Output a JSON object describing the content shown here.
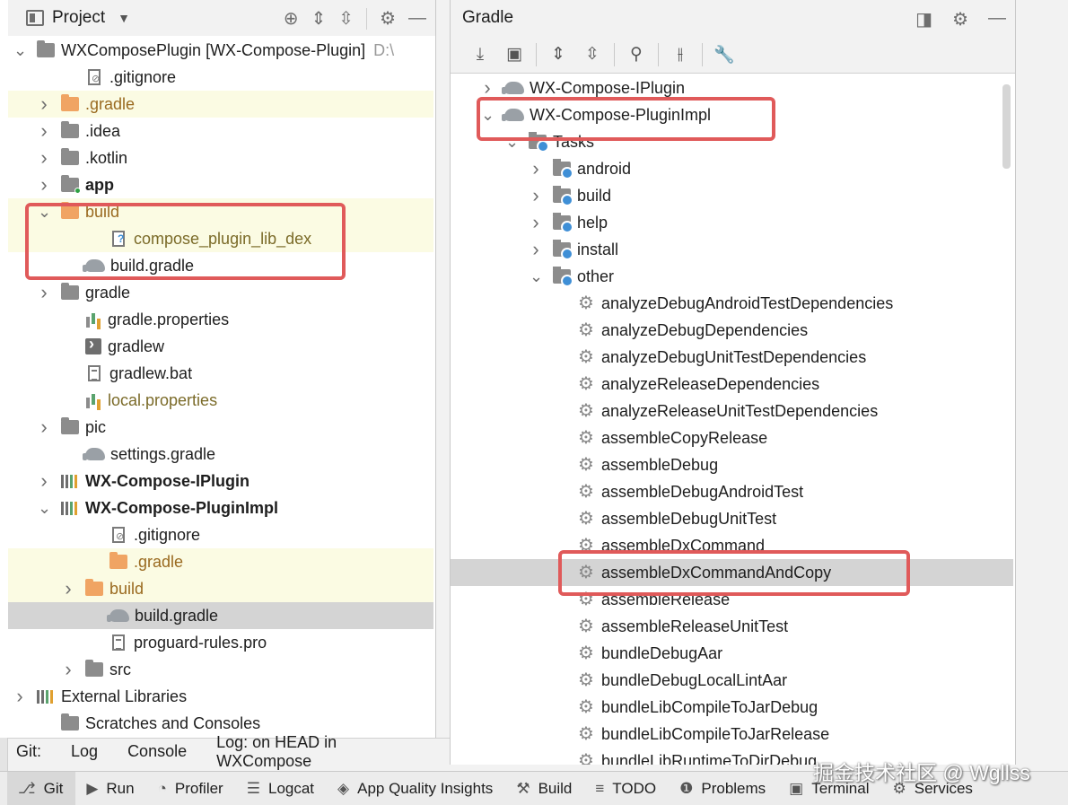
{
  "project_panel": {
    "title": "Project",
    "tree": [
      {
        "label": "WXComposePlugin [WX-Compose-Plugin]",
        "suffix": "D:\\",
        "indent": 0,
        "expanded": true,
        "icon": "module-folder-icon",
        "bold": false
      },
      {
        "label": ".gitignore",
        "indent": 2,
        "icon": "ignore-file-icon"
      },
      {
        "label": ".gradle",
        "indent": 1,
        "collapsed": true,
        "icon": "folder-orange-icon",
        "style": "gradle",
        "yellow": true
      },
      {
        "label": ".idea",
        "indent": 1,
        "collapsed": true,
        "icon": "folder-icon"
      },
      {
        "label": ".kotlin",
        "indent": 1,
        "collapsed": true,
        "icon": "folder-icon"
      },
      {
        "label": "app",
        "indent": 1,
        "collapsed": true,
        "icon": "module-app-icon",
        "bold": true
      },
      {
        "label": "build",
        "indent": 1,
        "expanded": true,
        "icon": "folder-orange-icon",
        "style": "gradle",
        "yellow": true
      },
      {
        "label": "compose_plugin_lib_dex",
        "indent": 3,
        "icon": "unknown-file-icon",
        "style": "olive",
        "yellow": true
      },
      {
        "label": "build.gradle",
        "indent": 2,
        "icon": "gradle-elephant-icon"
      },
      {
        "label": "gradle",
        "indent": 1,
        "collapsed": true,
        "icon": "folder-icon"
      },
      {
        "label": "gradle.properties",
        "indent": 2,
        "icon": "properties-icon"
      },
      {
        "label": "gradlew",
        "indent": 2,
        "icon": "terminal-file-icon"
      },
      {
        "label": "gradlew.bat",
        "indent": 2,
        "icon": "text-file-icon"
      },
      {
        "label": "local.properties",
        "indent": 2,
        "icon": "properties-icon",
        "style": "olive"
      },
      {
        "label": "pic",
        "indent": 1,
        "collapsed": true,
        "icon": "folder-icon"
      },
      {
        "label": "settings.gradle",
        "indent": 2,
        "icon": "gradle-elephant-icon"
      },
      {
        "label": "WX-Compose-IPlugin",
        "indent": 1,
        "collapsed": true,
        "icon": "module-icon",
        "bold": true
      },
      {
        "label": "WX-Compose-PluginImpl",
        "indent": 1,
        "expanded": true,
        "icon": "module-icon",
        "bold": true
      },
      {
        "label": ".gitignore",
        "indent": 3,
        "icon": "ignore-file-icon"
      },
      {
        "label": ".gradle",
        "indent": 3,
        "icon": "folder-orange-icon",
        "style": "gradle",
        "yellow": true
      },
      {
        "label": "build",
        "indent": 2,
        "collapsed": true,
        "icon": "folder-orange-icon",
        "style": "gradle",
        "yellow": true
      },
      {
        "label": "build.gradle",
        "indent": 3,
        "icon": "gradle-elephant-icon",
        "selected": true
      },
      {
        "label": "proguard-rules.pro",
        "indent": 3,
        "icon": "text-file-icon"
      },
      {
        "label": "src",
        "indent": 2,
        "collapsed": true,
        "icon": "folder-icon"
      },
      {
        "label": "External Libraries",
        "indent": 0,
        "collapsed": true,
        "icon": "library-icon"
      },
      {
        "label": "Scratches and Consoles",
        "indent": 1,
        "icon": "scratches-icon"
      }
    ]
  },
  "git_strip": {
    "label": "Git:",
    "tabs": [
      "Log",
      "Console",
      "Log: on HEAD in WXCompose"
    ]
  },
  "gradle_panel": {
    "title": "Gradle",
    "tree": [
      {
        "label": "WX-Compose-IPlugin",
        "indent": 0,
        "collapsed": true,
        "icon": "gradle-elephant-icon"
      },
      {
        "label": "WX-Compose-PluginImpl",
        "indent": 0,
        "expanded": true,
        "icon": "gradle-elephant-icon"
      },
      {
        "label": "Tasks",
        "indent": 1,
        "expanded": true,
        "icon": "task-folder-icon"
      },
      {
        "label": "android",
        "indent": 2,
        "collapsed": true,
        "icon": "task-folder-icon"
      },
      {
        "label": "build",
        "indent": 2,
        "collapsed": true,
        "icon": "task-folder-icon"
      },
      {
        "label": "help",
        "indent": 2,
        "collapsed": true,
        "icon": "task-folder-icon"
      },
      {
        "label": "install",
        "indent": 2,
        "collapsed": true,
        "icon": "task-folder-icon"
      },
      {
        "label": "other",
        "indent": 2,
        "expanded": true,
        "icon": "task-folder-icon"
      },
      {
        "label": "analyzeDebugAndroidTestDependencies",
        "indent": 3,
        "icon": "gear-icon"
      },
      {
        "label": "analyzeDebugDependencies",
        "indent": 3,
        "icon": "gear-icon"
      },
      {
        "label": "analyzeDebugUnitTestDependencies",
        "indent": 3,
        "icon": "gear-icon"
      },
      {
        "label": "analyzeReleaseDependencies",
        "indent": 3,
        "icon": "gear-icon"
      },
      {
        "label": "analyzeReleaseUnitTestDependencies",
        "indent": 3,
        "icon": "gear-icon"
      },
      {
        "label": "assembleCopyRelease",
        "indent": 3,
        "icon": "gear-icon"
      },
      {
        "label": "assembleDebug",
        "indent": 3,
        "icon": "gear-icon"
      },
      {
        "label": "assembleDebugAndroidTest",
        "indent": 3,
        "icon": "gear-icon"
      },
      {
        "label": "assembleDebugUnitTest",
        "indent": 3,
        "icon": "gear-icon"
      },
      {
        "label": "assembleDxCommand",
        "indent": 3,
        "icon": "gear-icon"
      },
      {
        "label": "assembleDxCommandAndCopy",
        "indent": 3,
        "icon": "gear-icon",
        "selected": true
      },
      {
        "label": "assembleRelease",
        "indent": 3,
        "icon": "gear-icon"
      },
      {
        "label": "assembleReleaseUnitTest",
        "indent": 3,
        "icon": "gear-icon"
      },
      {
        "label": "bundleDebugAar",
        "indent": 3,
        "icon": "gear-icon"
      },
      {
        "label": "bundleDebugLocalLintAar",
        "indent": 3,
        "icon": "gear-icon"
      },
      {
        "label": "bundleLibCompileToJarDebug",
        "indent": 3,
        "icon": "gear-icon"
      },
      {
        "label": "bundleLibCompileToJarRelease",
        "indent": 3,
        "icon": "gear-icon"
      },
      {
        "label": "bundleLibRuntimeToDirDebug",
        "indent": 3,
        "icon": "gear-icon"
      }
    ]
  },
  "bottom_bar": {
    "items": [
      {
        "label": "Git",
        "icon": "git-branch-icon",
        "active": true
      },
      {
        "label": "Run",
        "icon": "run-icon"
      },
      {
        "label": "Profiler",
        "icon": "profiler-icon"
      },
      {
        "label": "Logcat",
        "icon": "logcat-icon"
      },
      {
        "label": "App Quality Insights",
        "icon": "diamond-icon"
      },
      {
        "label": "Build",
        "icon": "hammer-icon"
      },
      {
        "label": "TODO",
        "icon": "list-icon"
      },
      {
        "label": "Problems",
        "icon": "info-icon"
      },
      {
        "label": "Terminal",
        "icon": "terminal-icon"
      },
      {
        "label": "Services",
        "icon": "services-icon"
      }
    ]
  },
  "watermark": "掘金技术社区 @ Wgllss",
  "colors": {
    "highlight": "#e05a5a",
    "selection": "#d4d4d4",
    "ignored_bg": "#fbfbe3",
    "gradle_dir": "#9a6a20",
    "task_badge": "#3f8fd6"
  }
}
